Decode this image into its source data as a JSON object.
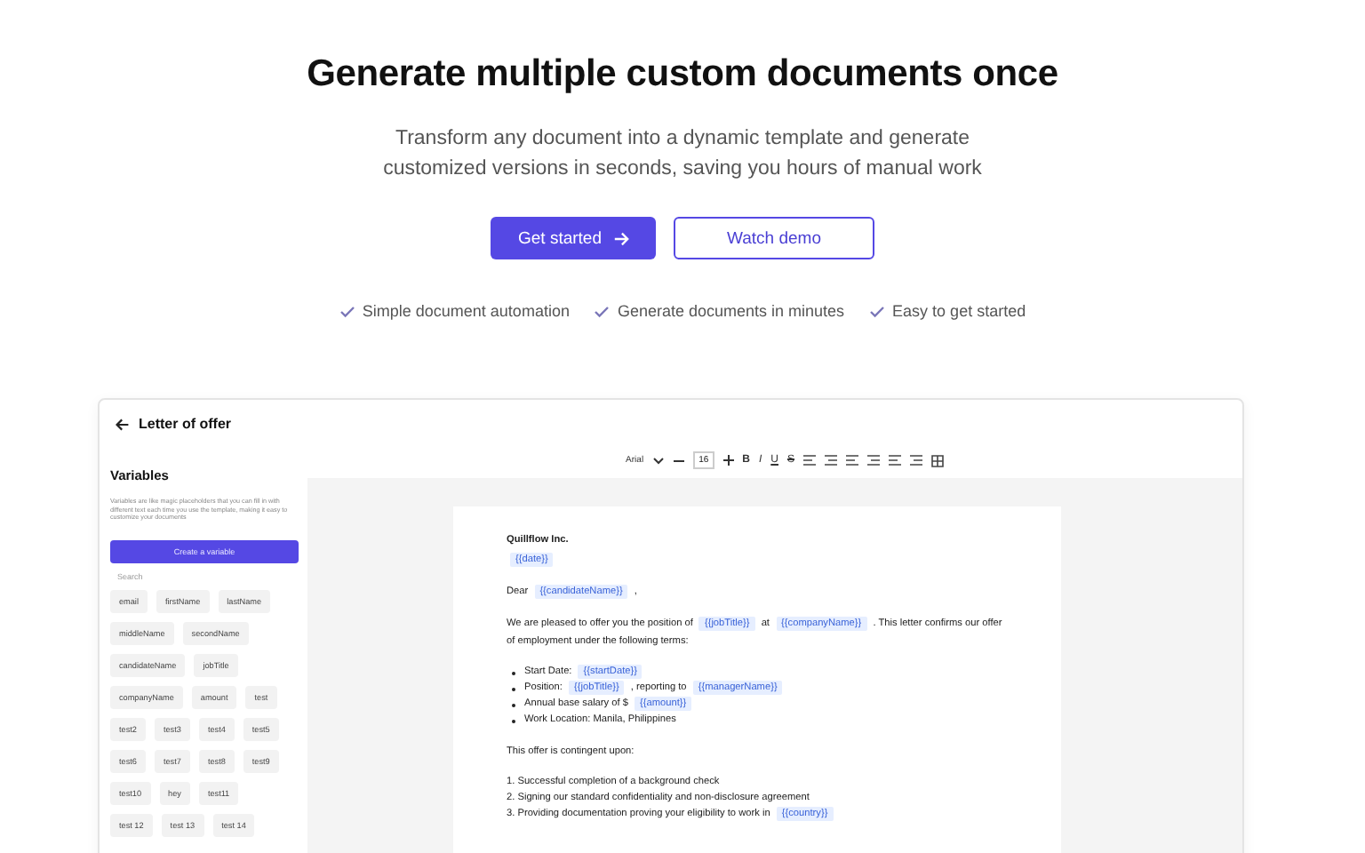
{
  "hero": {
    "title": "Generate multiple custom documents once",
    "subtitle": "Transform any document into a dynamic template and generate customized versions in seconds, saving you hours of manual work",
    "primary_button": "Get started",
    "secondary_button": "Watch demo",
    "features": [
      "Simple document automation",
      "Generate documents in minutes",
      "Easy to get started"
    ]
  },
  "editor": {
    "title": "Letter of offer",
    "sidebar": {
      "heading": "Variables",
      "description": "Variables are like magic placeholders that you can fill in with different text each time you use the template, making it easy to customize your documents",
      "create_button": "Create a variable",
      "search": {
        "placeholder": "Search"
      },
      "variables": [
        [
          "email",
          "firstName",
          "lastName"
        ],
        [
          "middleName",
          "secondName"
        ],
        [
          "candidateName",
          "jobTitle"
        ],
        [
          "companyName",
          "amount",
          "test"
        ],
        [
          "test2",
          "test3",
          "test4",
          "test5"
        ],
        [
          "test6",
          "test7",
          "test8",
          "test9"
        ],
        [
          "test10",
          "hey",
          "test11"
        ],
        [
          "test 12",
          "test 13",
          "test 14"
        ]
      ]
    },
    "toolbar": {
      "font": "Arial",
      "size": "16",
      "styles": [
        "B",
        "I",
        "U",
        "S"
      ]
    },
    "document": [
      {
        "kind": "paragraph",
        "bold": true,
        "segments": [
          {
            "kind": "text",
            "text": "Quillflow Inc."
          }
        ]
      },
      {
        "kind": "paragraph",
        "bold": false,
        "segments": [
          {
            "kind": "variable",
            "text": "{{date}}"
          }
        ]
      },
      {
        "kind": "paragraph",
        "bold": false,
        "segments": [
          {
            "kind": "text",
            "text": "Dear "
          },
          {
            "kind": "variable",
            "text": "{{candidateName}}"
          },
          {
            "kind": "text",
            "text": " ,"
          }
        ]
      },
      {
        "kind": "paragraph",
        "bold": false,
        "segments": [
          {
            "kind": "text",
            "text": "We are pleased to offer you the position of "
          },
          {
            "kind": "variable",
            "text": "{{jobTitle}}"
          },
          {
            "kind": "text",
            "text": " at "
          },
          {
            "kind": "variable",
            "text": "{{companyName}}"
          },
          {
            "kind": "text",
            "text": " . This letter confirms our offer of employment under the following terms:"
          }
        ]
      },
      {
        "kind": "bullets",
        "items": [
          [
            {
              "kind": "text",
              "text": "Start Date: "
            },
            {
              "kind": "variable",
              "text": "{{startDate}}"
            }
          ],
          [
            {
              "kind": "text",
              "text": "Position: "
            },
            {
              "kind": "variable",
              "text": "{{jobTitle}}"
            },
            {
              "kind": "text",
              "text": " , reporting to "
            },
            {
              "kind": "variable",
              "text": "{{managerName}}"
            }
          ],
          [
            {
              "kind": "text",
              "text": "Annual base salary of $ "
            },
            {
              "kind": "variable",
              "text": "{{amount}}"
            }
          ],
          [
            {
              "kind": "text",
              "text": "Work Location: Manila, Philippines"
            }
          ]
        ]
      },
      {
        "kind": "paragraph",
        "bold": false,
        "segments": [
          {
            "kind": "text",
            "text": "This offer is contingent upon:"
          }
        ]
      },
      {
        "kind": "numbered",
        "items": [
          [
            {
              "kind": "text",
              "text": "1. Successful completion of a background check"
            }
          ],
          [
            {
              "kind": "text",
              "text": "2. Signing our standard confidentiality and non-disclosure agreement"
            }
          ],
          [
            {
              "kind": "text",
              "text": "3. Providing documentation proving your eligibility to work in "
            },
            {
              "kind": "variable",
              "text": "{{country}}"
            }
          ]
        ]
      }
    ]
  }
}
